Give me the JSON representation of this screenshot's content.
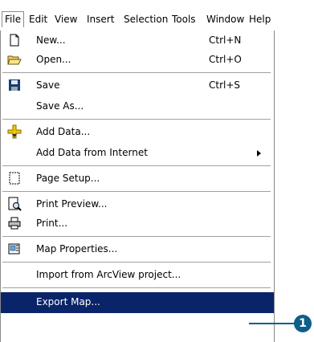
{
  "menubar": {
    "items": [
      {
        "label": "File"
      },
      {
        "label": "Edit"
      },
      {
        "label": "View"
      },
      {
        "label": "Insert"
      },
      {
        "label": "Selection"
      },
      {
        "label": "Tools"
      },
      {
        "label": "Window"
      },
      {
        "label": "Help"
      }
    ]
  },
  "file_menu": {
    "items": [
      {
        "label": "New...",
        "shortcut": "Ctrl+N",
        "icon": "new-document-icon"
      },
      {
        "label": "Open...",
        "shortcut": "Ctrl+O",
        "icon": "open-folder-icon"
      },
      {
        "label": "Save",
        "shortcut": "Ctrl+S",
        "icon": "save-disk-icon"
      },
      {
        "label": "Save As...",
        "shortcut": ""
      },
      {
        "label": "Add Data...",
        "shortcut": "",
        "icon": "add-data-icon"
      },
      {
        "label": "Add Data from Internet",
        "shortcut": "",
        "submenu": true
      },
      {
        "label": "Page Setup...",
        "shortcut": "",
        "icon": "page-setup-icon"
      },
      {
        "label": "Print Preview...",
        "shortcut": "",
        "icon": "print-preview-icon"
      },
      {
        "label": "Print...",
        "shortcut": "",
        "icon": "printer-icon"
      },
      {
        "label": "Map Properties...",
        "shortcut": "",
        "icon": "map-properties-icon"
      },
      {
        "label": "Import from ArcView project...",
        "shortcut": ""
      },
      {
        "label": "Export Map...",
        "shortcut": "",
        "highlighted": true
      }
    ]
  },
  "callout": {
    "number": "1",
    "color": "#0d5f8a"
  },
  "colors": {
    "highlight": "#0a246a",
    "accent": "#0d5f8a"
  }
}
